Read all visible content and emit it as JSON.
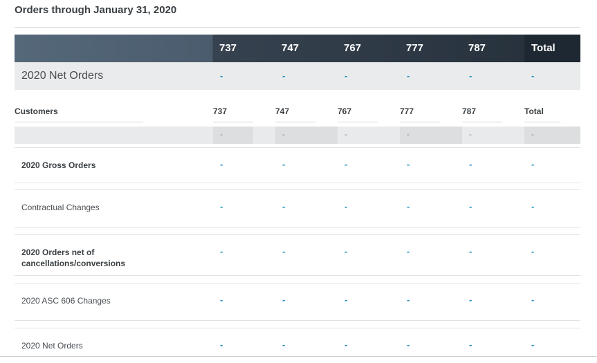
{
  "title": "Orders through January 31, 2020",
  "summary": {
    "columns": [
      "737",
      "747",
      "767",
      "777",
      "787",
      "Total"
    ],
    "row_label": "2020 Net Orders",
    "values": [
      "-",
      "-",
      "-",
      "-",
      "-",
      "-"
    ]
  },
  "customers": {
    "header_label": "Customers",
    "columns": [
      "737",
      "747",
      "767",
      "777",
      "787",
      "Total"
    ],
    "values": [
      "-",
      "-",
      "-",
      "-",
      "-",
      "-"
    ]
  },
  "rows": [
    {
      "label": "2020 Gross Orders",
      "bold": true,
      "values": [
        "-",
        "-",
        "-",
        "-",
        "-",
        "-"
      ]
    },
    {
      "label": "Contractual Changes",
      "bold": false,
      "values": [
        "-",
        "-",
        "-",
        "-",
        "-",
        "-"
      ]
    },
    {
      "label_line1": "2020 Orders net of",
      "label_line2": "cancellations/conversions",
      "bold": true,
      "values": [
        "-",
        "-",
        "-",
        "-",
        "-",
        "-"
      ]
    },
    {
      "label": "2020 ASC 606 Changes",
      "bold": false,
      "values": [
        "-",
        "-",
        "-",
        "-",
        "-",
        "-"
      ]
    },
    {
      "label": "2020 Net Orders",
      "bold": false,
      "values": [
        "-",
        "-",
        "-",
        "-",
        "-",
        "-"
      ]
    }
  ],
  "colors": {
    "accent_dash": "#1d8fbf",
    "header_dark": "#27323d",
    "header_light": "#55687a"
  }
}
